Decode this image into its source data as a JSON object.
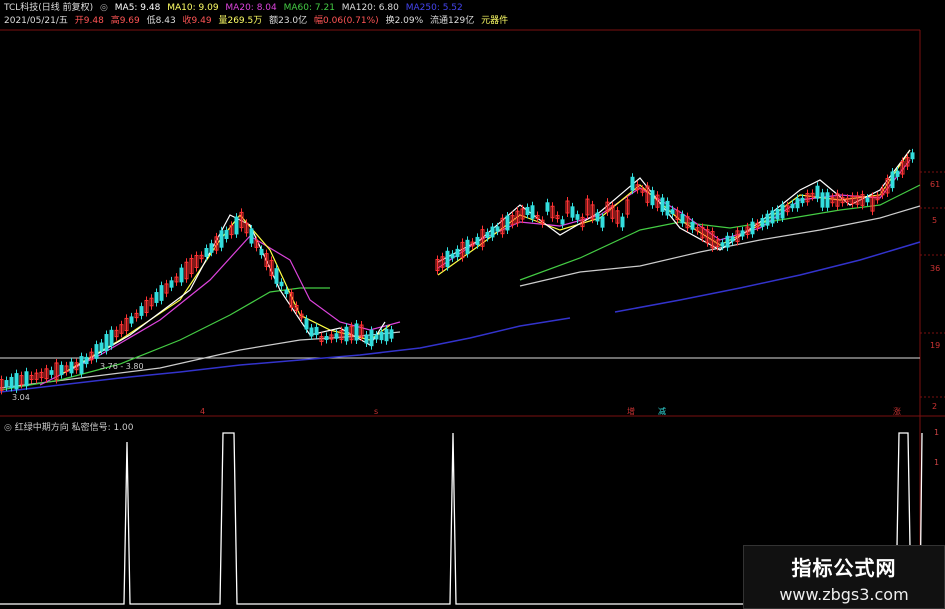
{
  "header": {
    "symbol": "TCL科技(日线 前复权)",
    "ma5": "MA5: 9.48",
    "ma10": "MA10: 9.09",
    "ma20": "MA20: 8.04",
    "ma60": "MA60: 7.21",
    "ma120": "MA120: 6.80",
    "ma250": "MA250: 5.52",
    "date": "2021/05/21/五",
    "open": "开9.48",
    "high": "高9.69",
    "low": "低8.43",
    "close": "收9.49",
    "volume": "量269.5万",
    "amount": "额23.0亿",
    "change": "幅0.06(0.71%)",
    "turnover": "换2.09%",
    "float_cap": "流通129亿",
    "sector": "元器件"
  },
  "price_axis": {
    "labels": [
      "61",
      "5",
      "36",
      "19",
      "2"
    ]
  },
  "annotations": {
    "range": "3.76 - 3.80",
    "low": "3.04"
  },
  "markers": [
    "4",
    "s",
    "增",
    "减",
    "涨"
  ],
  "indicator": {
    "title": "红绿中期方向 私密信号: 1.00"
  },
  "vol_axis": {
    "labels": [
      "1",
      "1",
      "0"
    ]
  },
  "watermark": {
    "title": "指标公式网",
    "url": "www.zbgs3.com"
  },
  "colors": {
    "ma5": "#ffffff",
    "ma10": "#ffff44",
    "ma20": "#dd44dd",
    "ma60": "#44cc44",
    "ma120": "#cccccc",
    "ma250": "#3333cc",
    "up": "#ff3333",
    "down": "#33dddd",
    "signal": "#ffffff"
  }
}
